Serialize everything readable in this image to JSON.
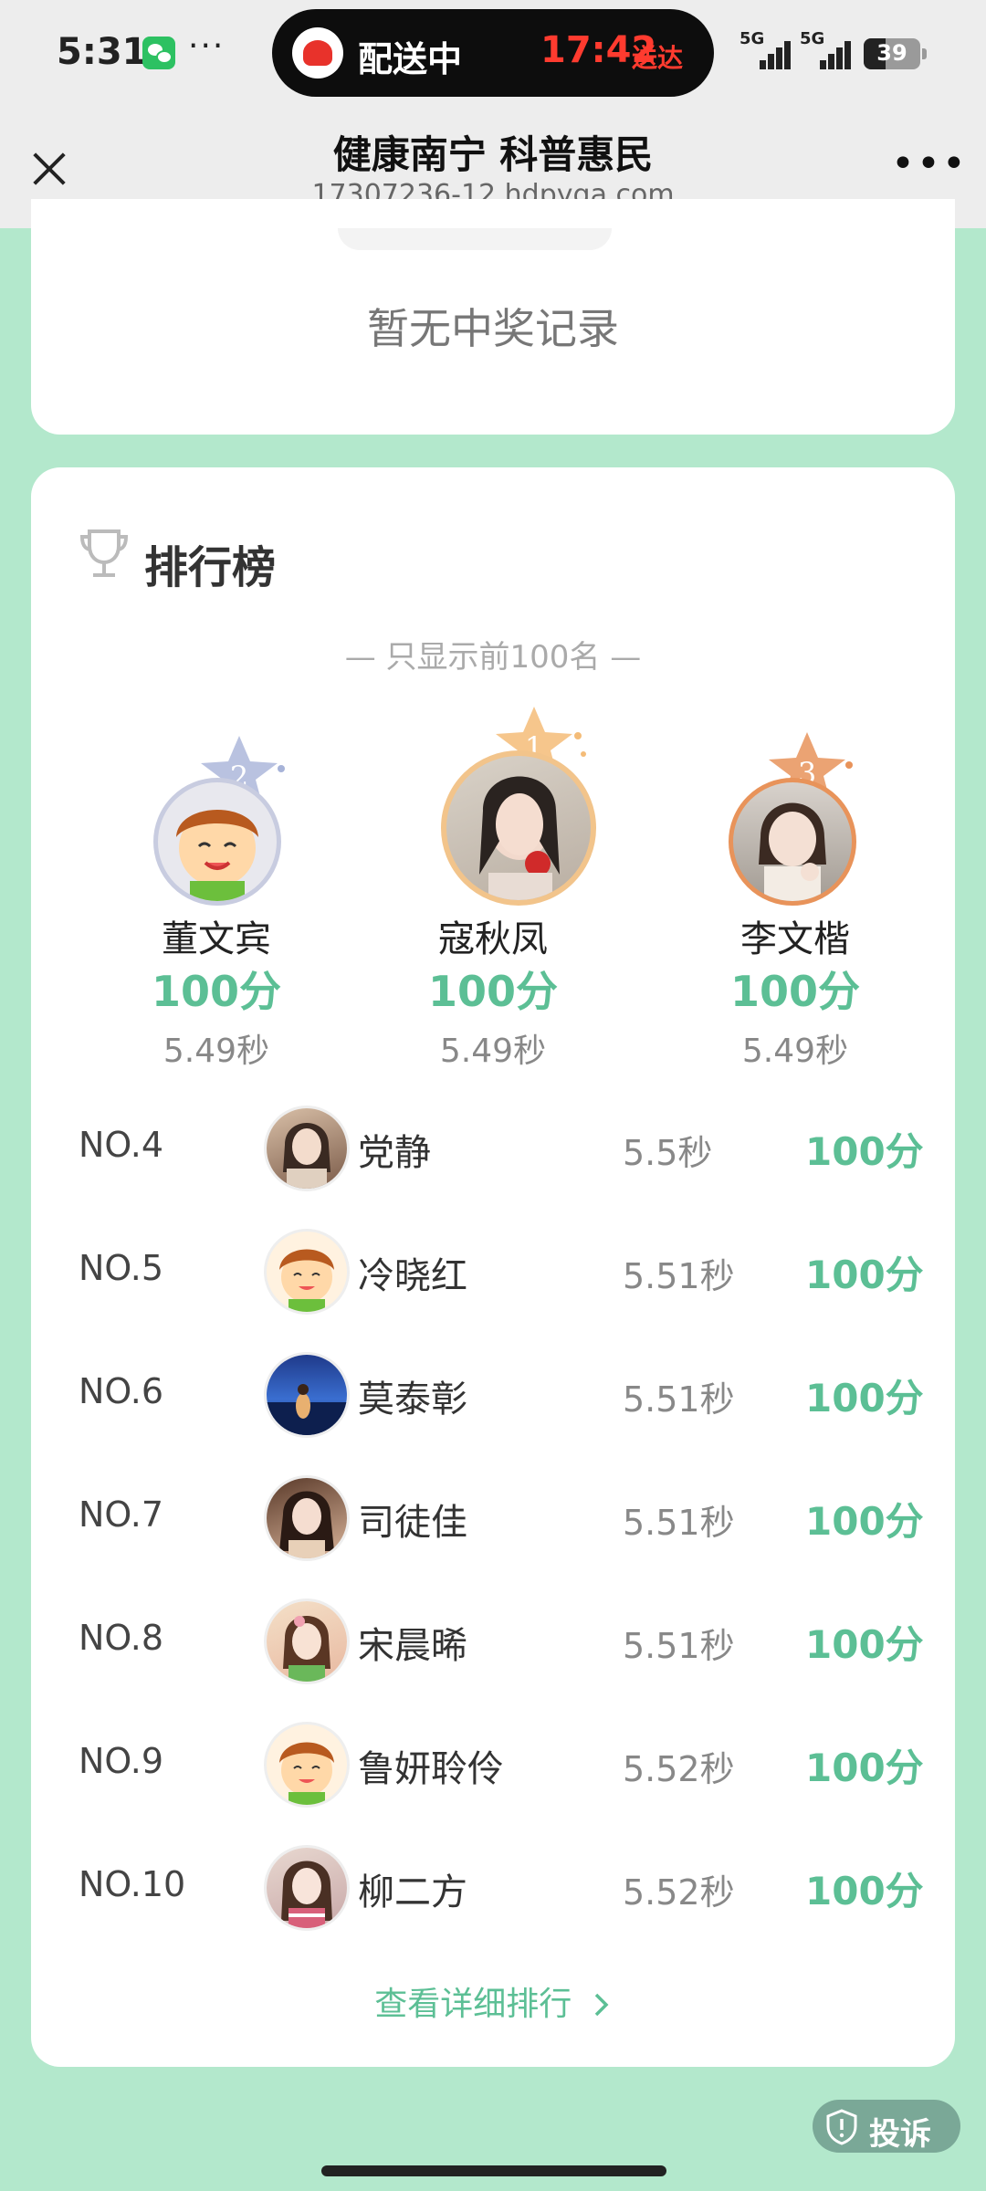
{
  "status_bar": {
    "time": "5:31",
    "more": "···",
    "delivery_label": "配送中",
    "delivery_time": "17:42",
    "delivery_suffix": "送达",
    "network": [
      "5G",
      "5G"
    ],
    "battery": "39",
    "battery_level": 0.39
  },
  "header": {
    "title": "健康南宁 科普惠民",
    "url": "17307236-12.hdpyqa.com"
  },
  "prize_card": {
    "empty_text": "暂无中奖记录"
  },
  "leaderboard": {
    "title": "排行榜",
    "subtitle": "— 只显示前100名 —",
    "podium": [
      {
        "rank": "2",
        "name": "董文宾",
        "score": "100分",
        "time": "5.49秒",
        "badge_color": "#a7b3d8",
        "avatar": "cartoon-boy"
      },
      {
        "rank": "1",
        "name": "寇秋凤",
        "score": "100分",
        "time": "5.49秒",
        "badge_color": "#f4bc78",
        "avatar": "photo"
      },
      {
        "rank": "3",
        "name": "李文楷",
        "score": "100分",
        "time": "5.49秒",
        "badge_color": "#e8935a",
        "avatar": "photo"
      }
    ],
    "rows": [
      {
        "no": "NO.4",
        "name": "党静",
        "time": "5.5秒",
        "score": "100分",
        "avatar": "photo"
      },
      {
        "no": "NO.5",
        "name": "冷晓红",
        "time": "5.51秒",
        "score": "100分",
        "avatar": "cartoon-boy"
      },
      {
        "no": "NO.6",
        "name": "莫泰彰",
        "time": "5.51秒",
        "score": "100分",
        "avatar": "photo-sea"
      },
      {
        "no": "NO.7",
        "name": "司徒佳",
        "time": "5.51秒",
        "score": "100分",
        "avatar": "photo"
      },
      {
        "no": "NO.8",
        "name": "宋晨晞",
        "time": "5.51秒",
        "score": "100分",
        "avatar": "photo"
      },
      {
        "no": "NO.9",
        "name": "鲁妍聆伶",
        "time": "5.52秒",
        "score": "100分",
        "avatar": "cartoon-boy"
      },
      {
        "no": "NO.10",
        "name": "柳二方",
        "time": "5.52秒",
        "score": "100分",
        "avatar": "photo"
      }
    ],
    "view_detail": "查看详细排行",
    "accent_color": "#5cbf95"
  },
  "complaint": {
    "label": "投诉"
  },
  "colors": {
    "page_bg": "#b3e8cc",
    "header_bg": "#ededed",
    "card_bg": "#ffffff"
  }
}
